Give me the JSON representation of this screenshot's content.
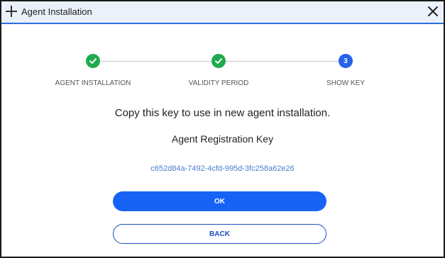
{
  "window": {
    "title": "Agent Installation",
    "title_icon": "plus-icon",
    "close_icon": "close-icon"
  },
  "stepper": {
    "steps": [
      {
        "label": "AGENT INSTALLATION",
        "state": "completed",
        "icon": "checkmark-icon"
      },
      {
        "label": "VALIDITY PERIOD",
        "state": "completed",
        "icon": "checkmark-icon"
      },
      {
        "label": "SHOW KEY",
        "state": "active",
        "number": "3"
      }
    ]
  },
  "content": {
    "instruction": "Copy this key to use in new agent installation.",
    "key_heading": "Agent Registration Key",
    "key_value": "c652d84a-7492-4cfd-995d-3fc258a62e26"
  },
  "buttons": {
    "ok_label": "OK",
    "back_label": "BACK"
  },
  "colors": {
    "completed": "#1eab4e",
    "active": "#2563eb",
    "primary": "#1763f5",
    "titlebar_accent": "#2d6fe0"
  }
}
